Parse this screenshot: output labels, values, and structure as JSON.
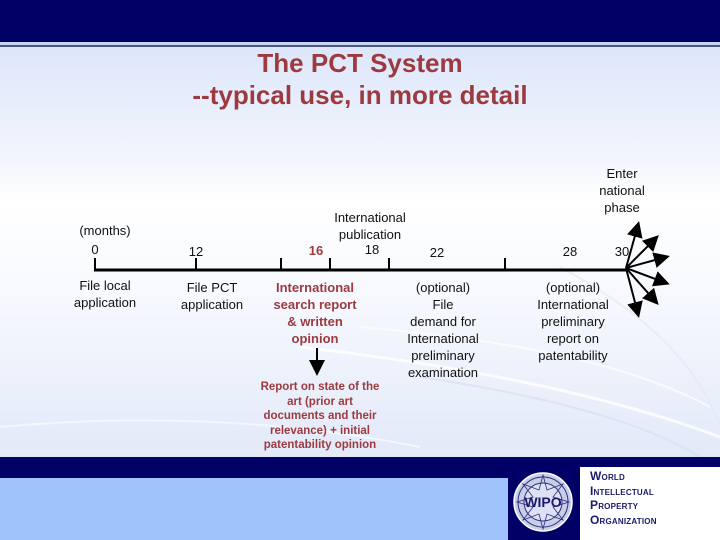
{
  "slide": {
    "title_line1": "The PCT System",
    "title_line2": "--typical use, in more detail"
  },
  "colors": {
    "header_navy": "#000066",
    "title_red": "#9c3a40",
    "footer_blue": "#9fc3fb"
  },
  "timeline": {
    "unit_label": "(months)",
    "ticks": [
      {
        "month": "0",
        "label": "0",
        "highlight": false
      },
      {
        "month": "12",
        "label": "12",
        "highlight": false
      },
      {
        "month": "16",
        "label": "16",
        "highlight": true
      },
      {
        "month": "18",
        "label": "18",
        "highlight": false
      },
      {
        "month": "22",
        "label": "22",
        "highlight": false
      },
      {
        "month": "28",
        "label": "28",
        "highlight": false
      },
      {
        "month": "30",
        "label": "30",
        "highlight": false
      }
    ],
    "above_labels": {
      "international_publication": [
        "International",
        "publication"
      ],
      "enter_national_phase": [
        "Enter",
        "national",
        "phase"
      ]
    },
    "events": {
      "file_local": [
        "File local",
        "application"
      ],
      "file_pct": [
        "File PCT",
        "application"
      ],
      "isr": [
        "International",
        "search report",
        "& written",
        "opinion"
      ],
      "demand": [
        "(optional)",
        "File",
        "demand for",
        "International",
        "preliminary",
        "examination"
      ],
      "iprp": [
        "(optional)",
        "International",
        "preliminary",
        "report on",
        "patentability"
      ]
    },
    "isr_detail": [
      "Report on state of the",
      "art (prior art",
      "documents and their",
      "relevance) + initial",
      "patentability opinion"
    ],
    "national_phase_arrows": 6
  },
  "footer": {
    "logo_emblem": "WIPO",
    "org_name": [
      "World",
      "Intellectual",
      "Property",
      "Organization"
    ]
  }
}
